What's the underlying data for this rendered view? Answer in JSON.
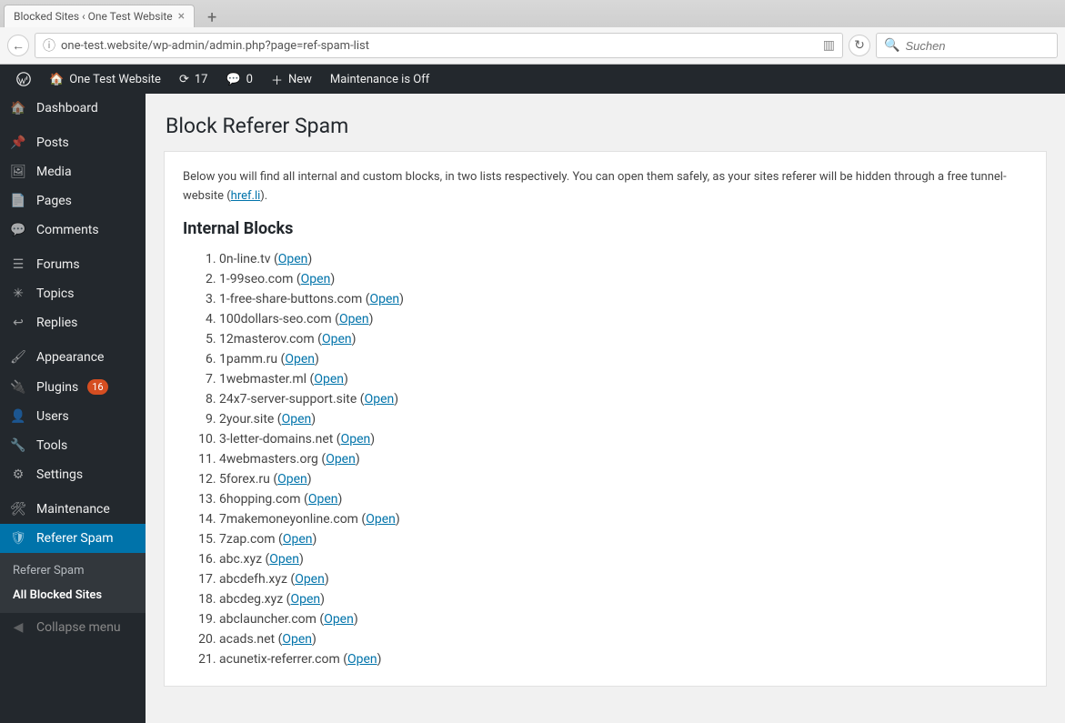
{
  "browser": {
    "tab_title": "Blocked Sites ‹ One Test Website",
    "url": "one-test.website/wp-admin/admin.php?page=ref-spam-list",
    "search_placeholder": "Suchen"
  },
  "adminbar": {
    "site_name": "One Test Website",
    "updates_count": "17",
    "comments_count": "0",
    "new_label": "New",
    "maintenance_label": "Maintenance is Off"
  },
  "sidebar": {
    "dashboard": "Dashboard",
    "posts": "Posts",
    "media": "Media",
    "pages": "Pages",
    "comments": "Comments",
    "forums": "Forums",
    "topics": "Topics",
    "replies": "Replies",
    "appearance": "Appearance",
    "plugins": "Plugins",
    "plugins_count": "16",
    "users": "Users",
    "tools": "Tools",
    "settings": "Settings",
    "maintenance": "Maintenance",
    "referer_spam": "Referer Spam",
    "sub_referer_spam": "Referer Spam",
    "sub_all_blocked": "All Blocked Sites",
    "collapse": "Collapse menu"
  },
  "page": {
    "title": "Block Referer Spam",
    "intro_before": "Below you will find all internal and custom blocks, in two lists respectively. You can open them safely, as your sites referer will be hidden through a free tunnel-website (",
    "intro_link": "href.li",
    "intro_after": ").",
    "section_title": "Internal Blocks",
    "open_label": "Open",
    "blocks": [
      "0n-line.tv",
      "1-99seo.com",
      "1-free-share-buttons.com",
      "100dollars-seo.com",
      "12masterov.com",
      "1pamm.ru",
      "1webmaster.ml",
      "24x7-server-support.site",
      "2your.site",
      "3-letter-domains.net",
      "4webmasters.org",
      "5forex.ru",
      "6hopping.com",
      "7makemoneyonline.com",
      "7zap.com",
      "abc.xyz",
      "abcdefh.xyz",
      "abcdeg.xyz",
      "abclauncher.com",
      "acads.net",
      "acunetix-referrer.com"
    ]
  }
}
